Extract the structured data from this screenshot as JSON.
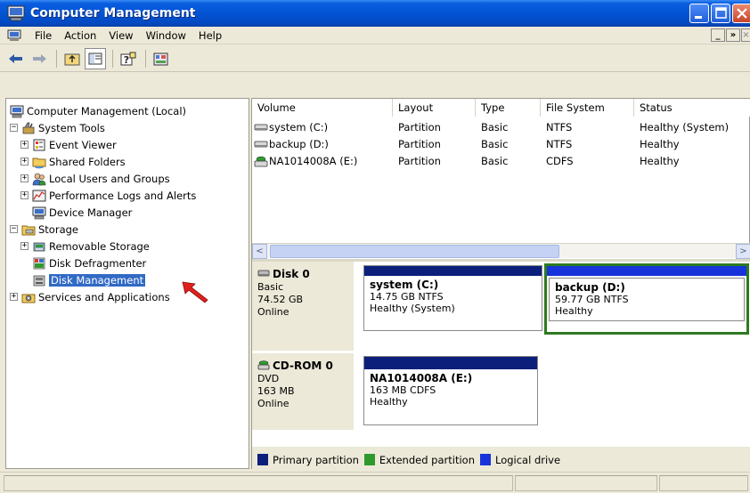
{
  "window": {
    "title": "Computer Management"
  },
  "menu": {
    "items": [
      "File",
      "Action",
      "View",
      "Window",
      "Help"
    ],
    "mdi": [
      "_",
      "»",
      "×"
    ]
  },
  "toolbar": {
    "icons": [
      "back-arrow-icon",
      "forward-arrow-icon",
      "up-folder-icon",
      "show-hide-tree-icon",
      "help-icon",
      "properties-icon"
    ]
  },
  "tree": {
    "root": "Computer Management (Local)",
    "system_tools": "System Tools",
    "event_viewer": "Event Viewer",
    "shared_folders": "Shared Folders",
    "local_users": "Local Users and Groups",
    "perf_logs": "Performance Logs and Alerts",
    "device_manager": "Device Manager",
    "storage": "Storage",
    "removable_storage": "Removable Storage",
    "disk_defrag": "Disk Defragmenter",
    "disk_management": "Disk Management",
    "services_apps": "Services and Applications",
    "expand_plus": "+",
    "collapse_minus": "−"
  },
  "volume_list": {
    "columns": [
      "Volume",
      "Layout",
      "Type",
      "File System",
      "Status"
    ],
    "rows": [
      {
        "volume": "system (C:)",
        "layout": "Partition",
        "type": "Basic",
        "fs": "NTFS",
        "status": "Healthy (System)"
      },
      {
        "volume": "backup (D:)",
        "layout": "Partition",
        "type": "Basic",
        "fs": "NTFS",
        "status": "Healthy"
      },
      {
        "volume": "NA1014008A (E:)",
        "layout": "Partition",
        "type": "Basic",
        "fs": "CDFS",
        "status": "Healthy"
      }
    ],
    "scroll_left": "<",
    "scroll_right": ">"
  },
  "disks": [
    {
      "name": "Disk 0",
      "kind": "Basic",
      "size": "74.52 GB",
      "state": "Online",
      "volumes": [
        {
          "name": "system  (C:)",
          "detail": "14.75 GB NTFS",
          "status": "Healthy (System)"
        },
        {
          "name": "backup  (D:)",
          "detail": "59.77 GB NTFS",
          "status": "Healthy"
        }
      ]
    },
    {
      "name": "CD-ROM 0",
      "kind": "DVD",
      "size": "163 MB",
      "state": "Online",
      "volumes": [
        {
          "name": "NA1014008A  (E:)",
          "detail": "163 MB CDFS",
          "status": "Healthy"
        }
      ]
    }
  ],
  "legend": [
    {
      "label": "Primary partition",
      "color": "#0c1f7a"
    },
    {
      "label": "Extended partition",
      "color": "#2e9a2e"
    },
    {
      "label": "Logical drive",
      "color": "#1733d9"
    }
  ],
  "colors": {
    "selection": "#316ac5",
    "titlebar": "#0354d4",
    "pointer_arrow": "#e0201c"
  }
}
